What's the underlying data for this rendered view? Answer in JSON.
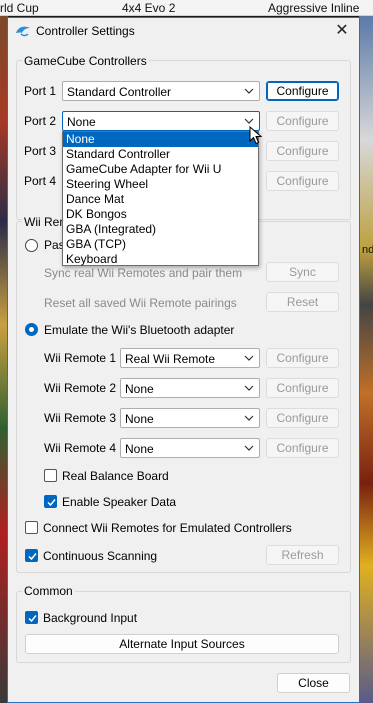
{
  "background": {
    "labels": [
      "rld Cup",
      "4x4 Evo 2",
      "Aggressive Inline"
    ],
    "side_fragment": "nde"
  },
  "window": {
    "title": "Controller Settings",
    "close_glyph": "✕"
  },
  "gamecube": {
    "title": "GameCube Controllers",
    "ports": [
      {
        "label": "Port 1",
        "value": "Standard Controller",
        "configure": "Configure"
      },
      {
        "label": "Port 2",
        "value": "None",
        "configure": "Configure"
      },
      {
        "label": "Port 3",
        "value": "",
        "configure": "Configure"
      },
      {
        "label": "Port 4",
        "value": "",
        "configure": "Configure"
      }
    ],
    "dropdown_options": [
      "None",
      "Standard Controller",
      "GameCube Adapter for Wii U",
      "Steering Wheel",
      "Dance Mat",
      "DK Bongos",
      "GBA (Integrated)",
      "GBA (TCP)",
      "Keyboard"
    ],
    "dropdown_selected": "None"
  },
  "wii": {
    "title": "Wii Remotes",
    "title_visible": "Wii Rem",
    "passthrough_label": "Pas",
    "sync_label": "Sync real Wii Remotes and pair them",
    "sync_button": "Sync",
    "reset_label": "Reset all saved Wii Remote pairings",
    "reset_button": "Reset",
    "emulate_label": "Emulate the Wii's Bluetooth adapter",
    "remotes": [
      {
        "label": "Wii Remote 1",
        "value": "Real Wii Remote",
        "configure": "Configure"
      },
      {
        "label": "Wii Remote 2",
        "value": "None",
        "configure": "Configure"
      },
      {
        "label": "Wii Remote 3",
        "value": "None",
        "configure": "Configure"
      },
      {
        "label": "Wii Remote 4",
        "value": "None",
        "configure": "Configure"
      }
    ],
    "balance_board": "Real Balance Board",
    "speaker_data": "Enable Speaker Data",
    "connect_emulated": "Connect Wii Remotes for Emulated Controllers",
    "continuous_scanning": "Continuous Scanning",
    "refresh_button": "Refresh"
  },
  "common": {
    "title": "Common",
    "background_input": "Background Input",
    "alternate_sources": "Alternate Input Sources"
  },
  "footer": {
    "close_button": "Close"
  },
  "colors": {
    "accent": "#0067c0",
    "window_border": "#2a6fbf",
    "dialog_bg": "#f0f0f0"
  }
}
